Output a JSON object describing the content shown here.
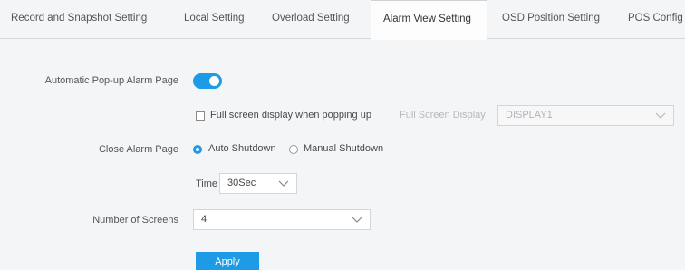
{
  "tabs": [
    {
      "label": "Record and Snapshot Setting"
    },
    {
      "label": "Local Setting"
    },
    {
      "label": "Overload Setting"
    },
    {
      "label": "Alarm View Setting",
      "active": true
    },
    {
      "label": "OSD Position Setting"
    },
    {
      "label": "POS Config"
    }
  ],
  "form": {
    "popup_label": "Automatic Pop-up Alarm Page",
    "popup_enabled": true,
    "fullscreen_label": "Full screen display when popping up",
    "fullscreen_checked": false,
    "fullscreen_display_label": "Full Screen Display",
    "fullscreen_display_value": "DISPLAY1",
    "close_label": "Close Alarm Page",
    "close_option_auto": "Auto Shutdown",
    "close_option_manual": "Manual Shutdown",
    "close_selected": "Auto Shutdown",
    "time_label": "Time",
    "time_value": "30Sec",
    "screens_label": "Number of Screens",
    "screens_value": "4",
    "apply_label": "Apply"
  },
  "colors": {
    "accent": "#1d9be6"
  }
}
